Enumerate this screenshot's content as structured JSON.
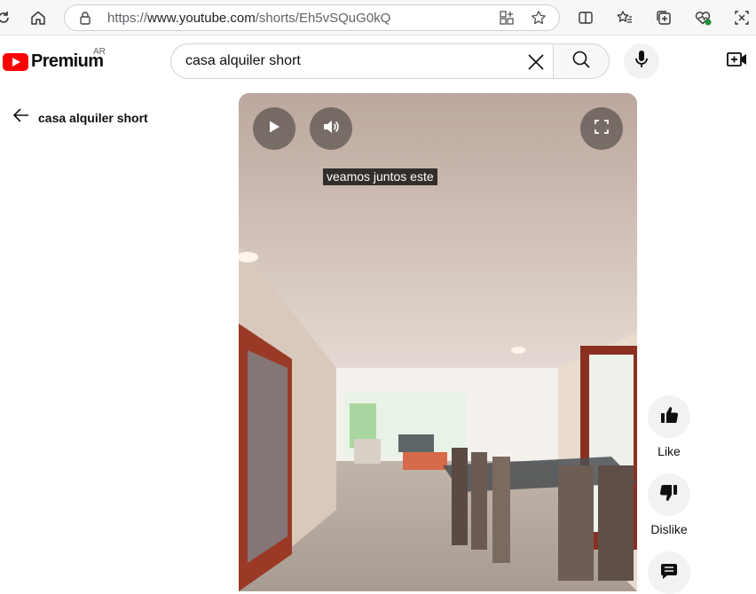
{
  "browser": {
    "url_prefix": "https://",
    "url_domain": "www.youtube.com",
    "url_path": "/shorts/Eh5vSQuG0kQ"
  },
  "header": {
    "logo_text": "Premium",
    "logo_sup": "AR",
    "search_query": "casa alquiler short"
  },
  "back": {
    "label": "casa alquiler short"
  },
  "player": {
    "caption": "veamos juntos este"
  },
  "actions": {
    "like_label": "Like",
    "dislike_label": "Dislike"
  },
  "colors": {
    "brand_red": "#ff0000",
    "text": "#0f0f0f",
    "chip_bg": "#f2f2f2"
  }
}
